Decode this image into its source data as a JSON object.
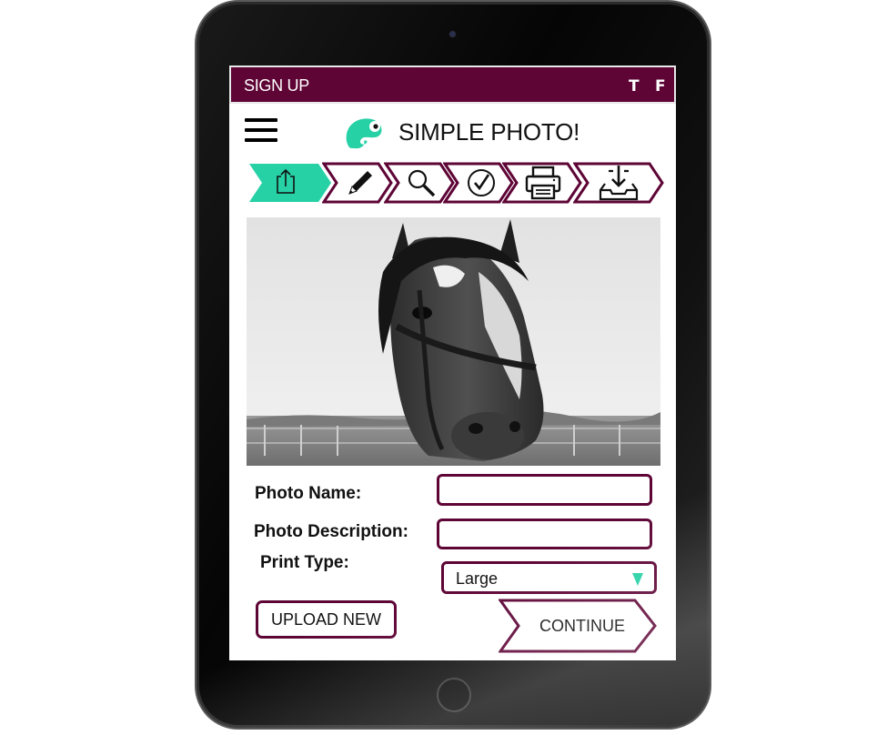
{
  "topbar": {
    "signup": "SIGN UP",
    "social_t": "T",
    "social_f": "F"
  },
  "header": {
    "title": "SIMPLE PHOTO!",
    "menu_icon": "hamburger-menu-icon",
    "logo_icon": "chameleon-logo-icon"
  },
  "steps": [
    {
      "name": "upload",
      "icon": "upload-icon",
      "active": true
    },
    {
      "name": "edit",
      "icon": "pencil-icon",
      "active": false
    },
    {
      "name": "preview",
      "icon": "magnifier-icon",
      "active": false
    },
    {
      "name": "confirm",
      "icon": "checkmark-icon",
      "active": false
    },
    {
      "name": "print",
      "icon": "printer-icon",
      "active": false
    },
    {
      "name": "download",
      "icon": "inbox-download-icon",
      "active": false
    }
  ],
  "photo": {
    "subject": "horse-photo"
  },
  "form": {
    "photo_name_label": "Photo Name:",
    "photo_name_value": "",
    "photo_description_label": "Photo Description:",
    "photo_description_value": "",
    "print_type_label": "Print Type:",
    "print_type_value": "Large"
  },
  "actions": {
    "upload_new": "UPLOAD NEW",
    "continue": "CONTINUE"
  },
  "colors": {
    "brand": "#5e0536",
    "accent": "#26d1a6"
  }
}
